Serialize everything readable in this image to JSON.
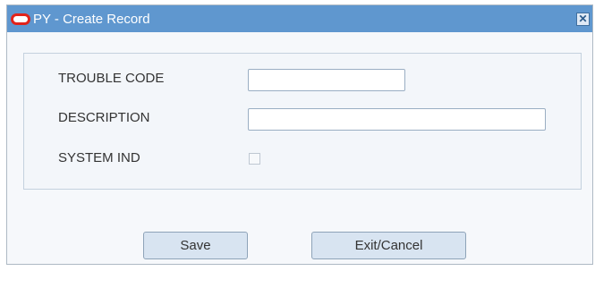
{
  "window": {
    "title": "PY - Create Record",
    "close_symbol": "✕"
  },
  "form": {
    "trouble_code": {
      "label": "TROUBLE CODE",
      "value": ""
    },
    "description": {
      "label": "DESCRIPTION",
      "value": ""
    },
    "system_ind": {
      "label": "SYSTEM IND",
      "checked": false
    }
  },
  "actions": {
    "save_label": "Save",
    "exit_cancel_label": "Exit/Cancel"
  },
  "icons": {
    "app_logo": "oracle-logo-icon",
    "close": "close-icon"
  },
  "colors": {
    "titlebar": "#5f97cf",
    "logo": "#e2231a",
    "button": "#d8e4f1"
  }
}
